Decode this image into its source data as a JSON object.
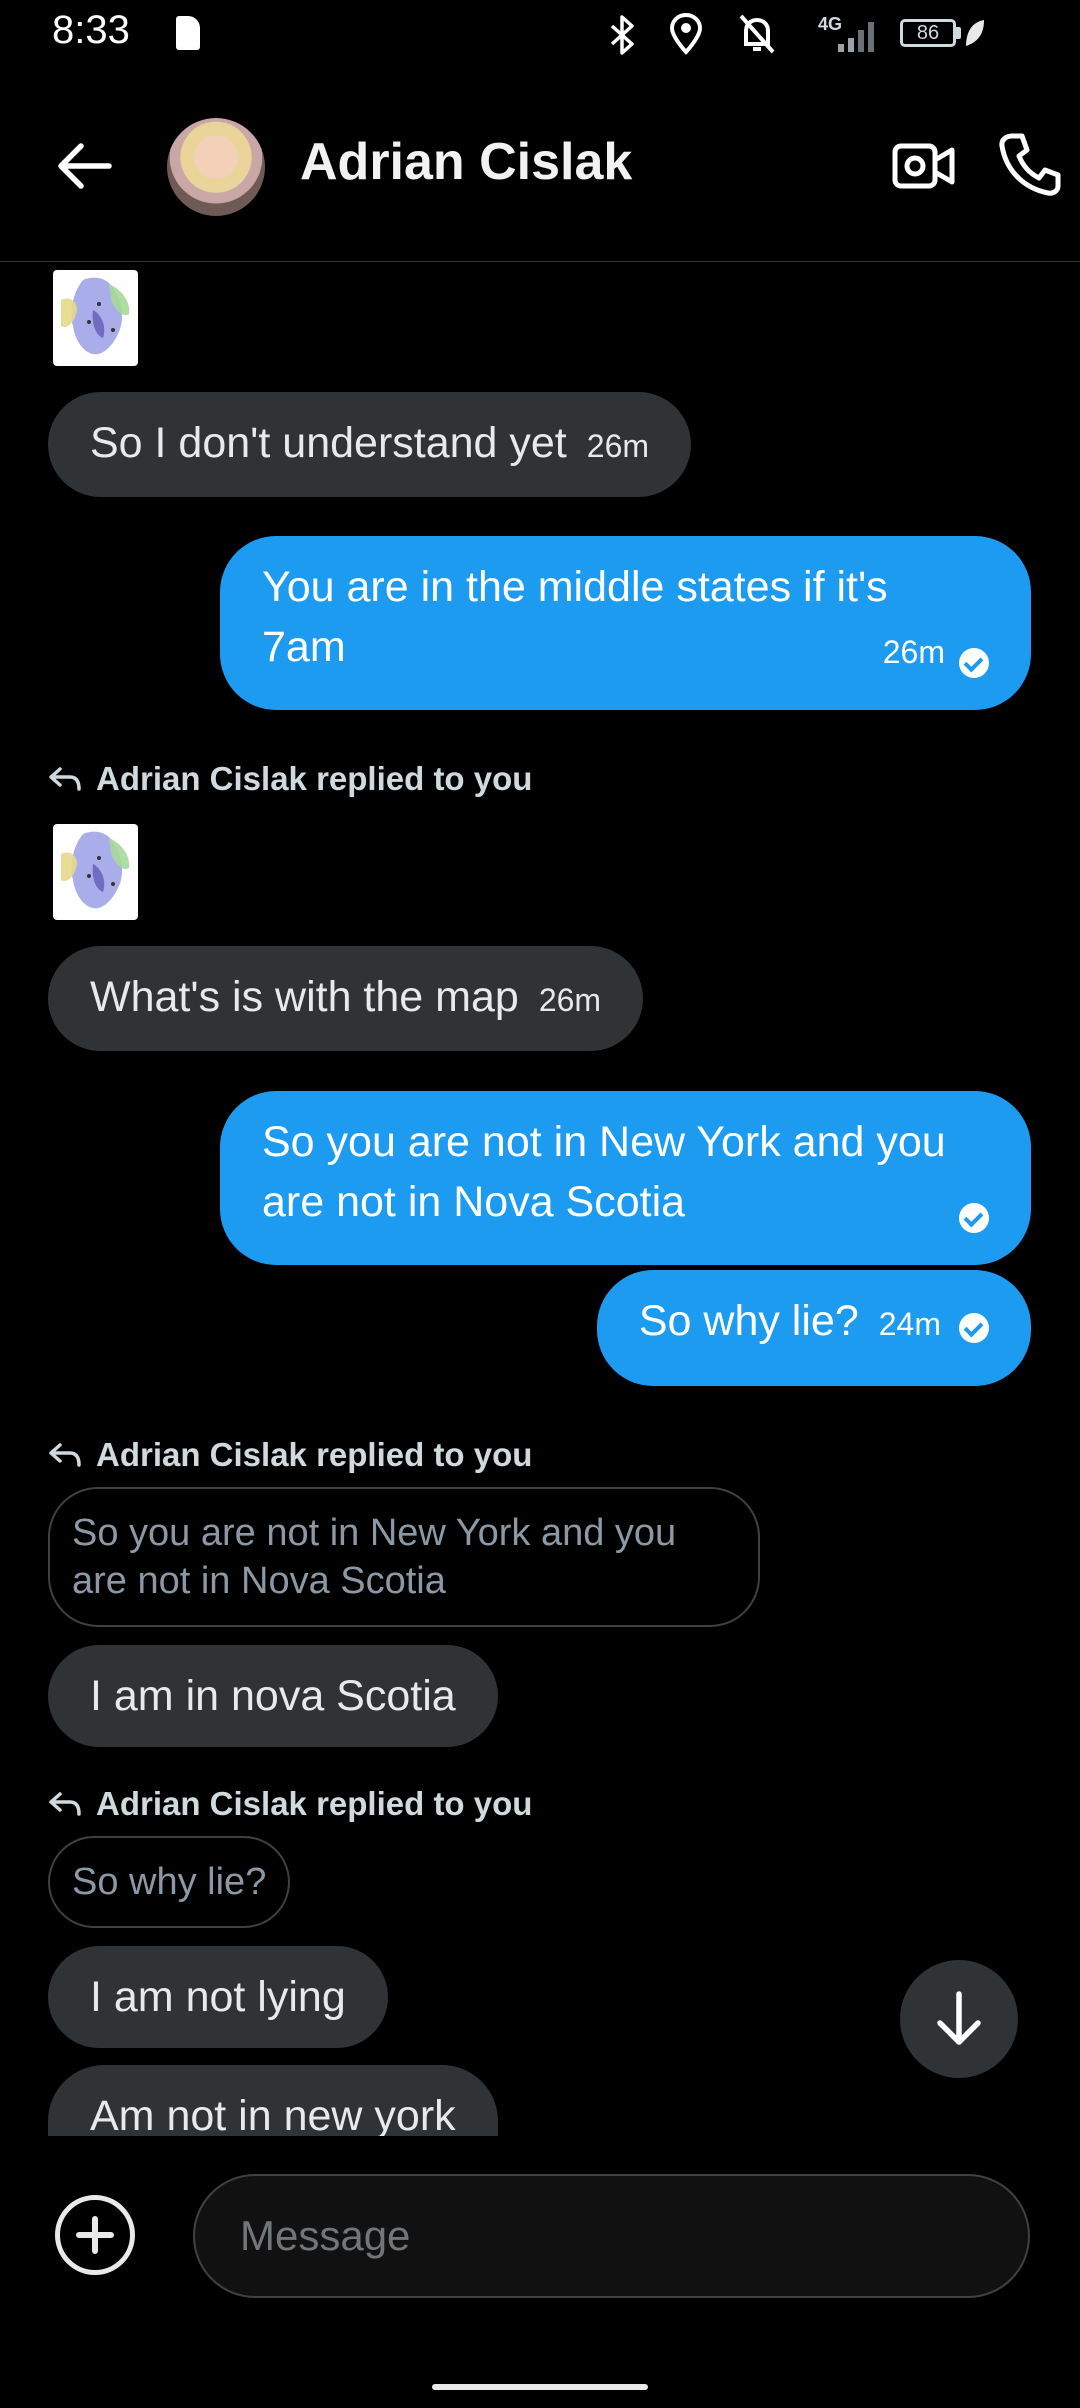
{
  "status_bar": {
    "time": "8:33",
    "network": "4G",
    "battery": "86"
  },
  "header": {
    "contact_name": "Adrian Cislak",
    "back_icon": "arrow-left-icon",
    "video_icon": "video-call-icon",
    "call_icon": "phone-call-icon"
  },
  "messages": {
    "m1_text": "So I don't understand yet",
    "m1_time": "26m",
    "m2_text_line1": "You are in the middle states if it's",
    "m2_text_line2": "7am",
    "m2_time": "26m",
    "reply_note_1": "Adrian Cislak replied to you",
    "m3_text": "What's is with the map",
    "m3_time": "26m",
    "m4_text_line1": "So you are not in New York and you",
    "m4_text_line2": "are not in Nova Scotia",
    "m5_text": "So why lie?",
    "m5_time": "24m",
    "reply_note_2": "Adrian Cislak replied to you",
    "quote_1_line1": "So you are not in New York and you",
    "quote_1_line2": "are not in Nova Scotia",
    "m6_text": "I am in nova Scotia",
    "reply_note_3": "Adrian Cislak replied to you",
    "quote_2": "So why lie?",
    "m7_text": "I am not lying",
    "m8_text": "Am not in new york"
  },
  "composer": {
    "placeholder": "Message"
  },
  "colors": {
    "background": "#000000",
    "incoming_bubble": "#2f3336",
    "outgoing_bubble": "#1d9bf0"
  }
}
